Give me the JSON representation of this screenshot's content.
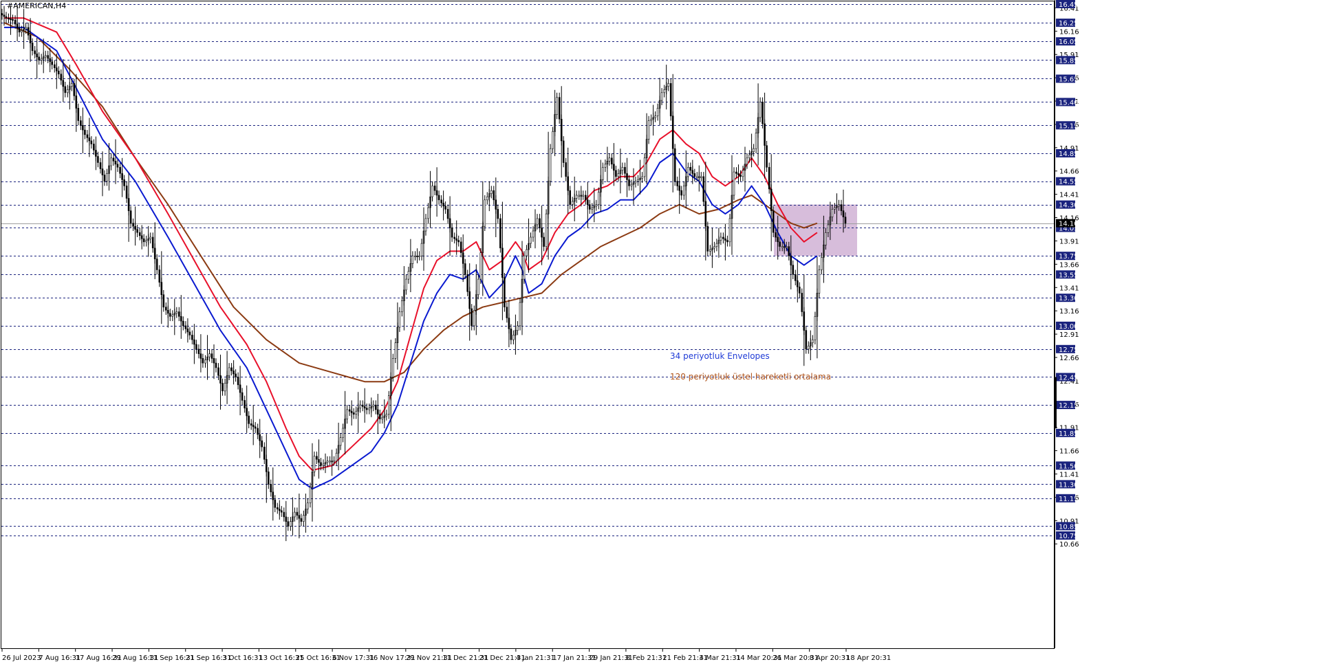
{
  "symbol_label": "#AMERICAN,H4",
  "chart_data": {
    "type": "candlestick",
    "y_range": [
      10.6,
      16.5
    ],
    "colors": {
      "candle": "#000000",
      "envelope_upper": "#e8102a",
      "envelope_lower": "#0a1ad0",
      "ema120": "#8b3a12",
      "box_fill": "#c9a7cf",
      "grid": "#1a237e",
      "price_badge": "#1a237e",
      "current_badge": "#000000"
    },
    "right_axis_ticks": [
      "16.41",
      "16.16",
      "15.91",
      "15.66",
      "15.41",
      "15.16",
      "14.91",
      "14.66",
      "14.41",
      "14.16",
      "13.91",
      "13.66",
      "13.41",
      "13.16",
      "12.91",
      "12.66",
      "12.41",
      "12.16",
      "11.91",
      "11.66",
      "11.41",
      "11.16",
      "10.91",
      "10.66"
    ],
    "level_lines": [
      "16.45",
      "16.25",
      "16.05",
      "15.85",
      "15.65",
      "15.40",
      "15.15",
      "14.85",
      "14.55",
      "14.30",
      "14.05",
      "13.75",
      "13.55",
      "13.30",
      "13.00",
      "12.75",
      "12.45",
      "12.15",
      "11.85",
      "11.50",
      "11.30",
      "11.15",
      "10.85",
      "10.75"
    ],
    "current_price": "14.10",
    "date_labels": [
      "26 Jul 2023",
      "7 Aug 16:31",
      "17 Aug 16:31",
      "29 Aug 16:31",
      "11 Sep 16:31",
      "21 Sep 16:31",
      "3 Oct 16:31",
      "13 Oct 16:31",
      "25 Oct 16:31",
      "6 Nov 17:31",
      "16 Nov 17:31",
      "29 Nov 21:31",
      "11 Dec 21:31",
      "21 Dec 21:31",
      "4 Jan 21:31",
      "17 Jan 21:31",
      "29 Jan 21:31",
      "8 Feb 21:31",
      "21 Feb 21:31",
      "4 Mar 21:31",
      "14 Mar 20:31",
      "26 Mar 20:31",
      "8 Apr 20:31",
      "18 Apr 20:31"
    ],
    "envelope_upper": [
      [
        0,
        16.3
      ],
      [
        3,
        16.3
      ],
      [
        8,
        16.15
      ],
      [
        11,
        15.8
      ],
      [
        15,
        15.3
      ],
      [
        20,
        14.8
      ],
      [
        25,
        14.2
      ],
      [
        29,
        13.7
      ],
      [
        33,
        13.2
      ],
      [
        37,
        12.8
      ],
      [
        40,
        12.4
      ],
      [
        43,
        11.9
      ],
      [
        45,
        11.6
      ],
      [
        47,
        11.45
      ],
      [
        50,
        11.5
      ],
      [
        53,
        11.7
      ],
      [
        56,
        11.9
      ],
      [
        58,
        12.1
      ],
      [
        60,
        12.4
      ],
      [
        62,
        12.9
      ],
      [
        64,
        13.4
      ],
      [
        66,
        13.7
      ],
      [
        68,
        13.8
      ],
      [
        70,
        13.8
      ],
      [
        72,
        13.9
      ],
      [
        74,
        13.6
      ],
      [
        76,
        13.7
      ],
      [
        78,
        13.9
      ],
      [
        79,
        13.8
      ],
      [
        80,
        13.6
      ],
      [
        82,
        13.7
      ],
      [
        84,
        14.0
      ],
      [
        86,
        14.2
      ],
      [
        88,
        14.3
      ],
      [
        90,
        14.45
      ],
      [
        92,
        14.5
      ],
      [
        94,
        14.6
      ],
      [
        96,
        14.6
      ],
      [
        98,
        14.75
      ],
      [
        100,
        15.0
      ],
      [
        102,
        15.1
      ],
      [
        104,
        14.95
      ],
      [
        106,
        14.85
      ],
      [
        108,
        14.6
      ],
      [
        110,
        14.5
      ],
      [
        112,
        14.6
      ],
      [
        114,
        14.8
      ],
      [
        116,
        14.6
      ],
      [
        118,
        14.3
      ],
      [
        120,
        14.05
      ],
      [
        122,
        13.9
      ],
      [
        124,
        14.0
      ]
    ],
    "envelope_lower": [
      [
        0,
        16.2
      ],
      [
        3,
        16.2
      ],
      [
        8,
        15.95
      ],
      [
        11,
        15.55
      ],
      [
        15,
        15.0
      ],
      [
        20,
        14.55
      ],
      [
        25,
        13.95
      ],
      [
        29,
        13.45
      ],
      [
        33,
        12.95
      ],
      [
        37,
        12.55
      ],
      [
        40,
        12.1
      ],
      [
        43,
        11.65
      ],
      [
        45,
        11.35
      ],
      [
        47,
        11.25
      ],
      [
        50,
        11.35
      ],
      [
        53,
        11.5
      ],
      [
        56,
        11.65
      ],
      [
        58,
        11.85
      ],
      [
        60,
        12.15
      ],
      [
        62,
        12.6
      ],
      [
        64,
        13.05
      ],
      [
        66,
        13.35
      ],
      [
        68,
        13.55
      ],
      [
        70,
        13.5
      ],
      [
        72,
        13.6
      ],
      [
        74,
        13.3
      ],
      [
        76,
        13.45
      ],
      [
        78,
        13.75
      ],
      [
        79,
        13.6
      ],
      [
        80,
        13.35
      ],
      [
        82,
        13.45
      ],
      [
        84,
        13.75
      ],
      [
        86,
        13.95
      ],
      [
        88,
        14.05
      ],
      [
        90,
        14.2
      ],
      [
        92,
        14.25
      ],
      [
        94,
        14.35
      ],
      [
        96,
        14.35
      ],
      [
        98,
        14.5
      ],
      [
        100,
        14.75
      ],
      [
        102,
        14.85
      ],
      [
        104,
        14.65
      ],
      [
        106,
        14.55
      ],
      [
        108,
        14.3
      ],
      [
        110,
        14.2
      ],
      [
        112,
        14.3
      ],
      [
        114,
        14.5
      ],
      [
        116,
        14.3
      ],
      [
        118,
        14.0
      ],
      [
        120,
        13.75
      ],
      [
        122,
        13.65
      ],
      [
        124,
        13.75
      ]
    ],
    "ema120": [
      [
        0,
        16.25
      ],
      [
        5,
        16.1
      ],
      [
        10,
        15.75
      ],
      [
        15,
        15.35
      ],
      [
        20,
        14.8
      ],
      [
        25,
        14.3
      ],
      [
        30,
        13.75
      ],
      [
        35,
        13.2
      ],
      [
        40,
        12.85
      ],
      [
        45,
        12.6
      ],
      [
        50,
        12.5
      ],
      [
        55,
        12.4
      ],
      [
        58,
        12.4
      ],
      [
        61,
        12.5
      ],
      [
        64,
        12.75
      ],
      [
        67,
        12.95
      ],
      [
        70,
        13.1
      ],
      [
        73,
        13.2
      ],
      [
        76,
        13.25
      ],
      [
        79,
        13.3
      ],
      [
        82,
        13.35
      ],
      [
        85,
        13.55
      ],
      [
        88,
        13.7
      ],
      [
        91,
        13.85
      ],
      [
        94,
        13.95
      ],
      [
        97,
        14.05
      ],
      [
        100,
        14.2
      ],
      [
        103,
        14.3
      ],
      [
        106,
        14.2
      ],
      [
        109,
        14.25
      ],
      [
        112,
        14.35
      ],
      [
        114,
        14.4
      ],
      [
        116,
        14.3
      ],
      [
        118,
        14.2
      ],
      [
        120,
        14.1
      ],
      [
        122,
        14.05
      ],
      [
        124,
        14.1
      ]
    ],
    "candles_close": [
      16.3,
      16.28,
      16.15,
      16.2,
      15.95,
      15.85,
      15.9,
      15.8,
      15.7,
      15.5,
      15.6,
      15.2,
      15.05,
      14.95,
      14.75,
      14.55,
      14.8,
      14.7,
      14.5,
      14.1,
      14.0,
      13.9,
      13.95,
      13.6,
      13.2,
      13.1,
      13.15,
      13.0,
      12.9,
      12.75,
      12.6,
      12.7,
      12.55,
      12.3,
      12.55,
      12.45,
      12.2,
      11.95,
      11.9,
      11.7,
      11.3,
      11.05,
      11.0,
      10.85,
      11.0,
      10.9,
      11.1,
      11.6,
      11.5,
      11.55,
      11.55,
      11.8,
      12.1,
      12.05,
      12.15,
      12.1,
      12.15,
      12.0,
      12.05,
      12.65,
      13.15,
      13.5,
      13.75,
      13.75,
      14.15,
      14.5,
      14.35,
      14.25,
      13.95,
      13.9,
      13.55,
      13.0,
      13.5,
      14.35,
      14.45,
      14.15,
      13.2,
      12.85,
      13.0,
      13.75,
      13.95,
      14.15,
      13.85,
      14.9,
      15.45,
      14.75,
      14.3,
      14.4,
      14.4,
      14.25,
      14.3,
      14.7,
      14.8,
      14.6,
      14.7,
      14.5,
      14.55,
      14.6,
      15.2,
      15.25,
      15.5,
      15.6,
      14.55,
      14.4,
      14.7,
      14.6,
      14.6,
      13.8,
      13.85,
      13.95,
      13.9,
      14.65,
      14.6,
      14.8,
      14.9,
      15.4,
      14.7,
      14.0,
      13.85,
      13.85,
      13.55,
      13.35,
      12.75,
      12.85,
      13.6,
      14.0,
      14.25,
      14.3,
      14.1
    ]
  }
}
